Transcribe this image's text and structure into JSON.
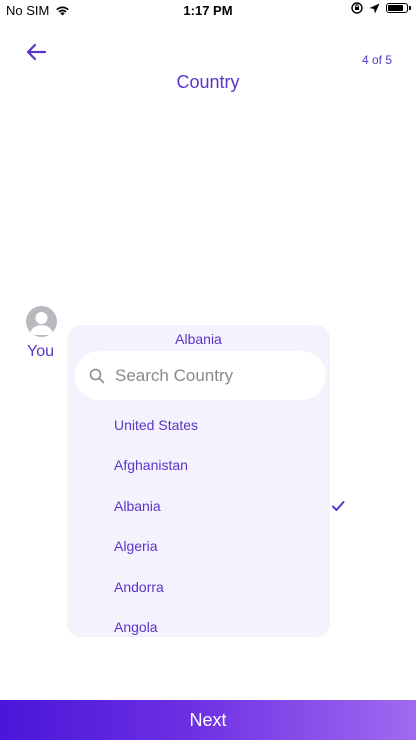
{
  "status_bar": {
    "carrier": "No SIM",
    "time": "1:17 PM"
  },
  "header": {
    "step": "4 of 5",
    "title": "Country"
  },
  "user": {
    "label": "You"
  },
  "dropdown": {
    "selected": "Albania",
    "search_placeholder": "Search Country",
    "search_value": "",
    "items": [
      "United States",
      "Afghanistan",
      "Albania",
      "Algeria",
      "Andorra",
      "Angola"
    ]
  },
  "footer": {
    "next_label": "Next"
  },
  "colors": {
    "accent": "#5a35c9",
    "panel": "#f4f2fc",
    "gradient_start": "#4a16d9",
    "gradient_end": "#a16af0"
  },
  "icons": [
    "wifi-icon",
    "screen-lock-icon",
    "location-icon",
    "battery-icon",
    "back-arrow-icon",
    "user-icon",
    "search-icon",
    "check-icon"
  ]
}
